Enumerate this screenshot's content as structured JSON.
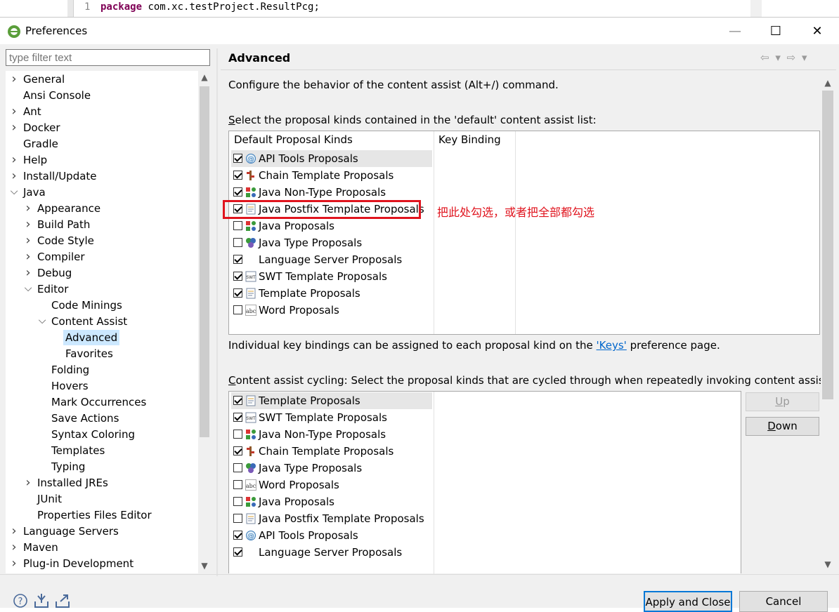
{
  "editor": {
    "line_number": "1",
    "keyword": "package",
    "code": " com.xc.testProject.ResultPcg;"
  },
  "window": {
    "title": "Preferences",
    "minimize_glyph": "—",
    "maximize_glyph": "☐",
    "close_glyph": "✕"
  },
  "filter": {
    "placeholder": "type filter text"
  },
  "tree": [
    {
      "label": "General",
      "level": 0,
      "chevron": ">"
    },
    {
      "label": "Ansi Console",
      "level": 0,
      "chevron": ""
    },
    {
      "label": "Ant",
      "level": 0,
      "chevron": ">"
    },
    {
      "label": "Docker",
      "level": 0,
      "chevron": ">"
    },
    {
      "label": "Gradle",
      "level": 0,
      "chevron": ""
    },
    {
      "label": "Help",
      "level": 0,
      "chevron": ">"
    },
    {
      "label": "Install/Update",
      "level": 0,
      "chevron": ">"
    },
    {
      "label": "Java",
      "level": 0,
      "chevron": "v"
    },
    {
      "label": "Appearance",
      "level": 1,
      "chevron": ">"
    },
    {
      "label": "Build Path",
      "level": 1,
      "chevron": ">"
    },
    {
      "label": "Code Style",
      "level": 1,
      "chevron": ">"
    },
    {
      "label": "Compiler",
      "level": 1,
      "chevron": ">"
    },
    {
      "label": "Debug",
      "level": 1,
      "chevron": ">"
    },
    {
      "label": "Editor",
      "level": 1,
      "chevron": "v"
    },
    {
      "label": "Code Minings",
      "level": 2,
      "chevron": ""
    },
    {
      "label": "Content Assist",
      "level": 2,
      "chevron": "v"
    },
    {
      "label": "Advanced",
      "level": 3,
      "chevron": "",
      "selected": true
    },
    {
      "label": "Favorites",
      "level": 3,
      "chevron": ""
    },
    {
      "label": "Folding",
      "level": 2,
      "chevron": ""
    },
    {
      "label": "Hovers",
      "level": 2,
      "chevron": ""
    },
    {
      "label": "Mark Occurrences",
      "level": 2,
      "chevron": ""
    },
    {
      "label": "Save Actions",
      "level": 2,
      "chevron": ""
    },
    {
      "label": "Syntax Coloring",
      "level": 2,
      "chevron": ""
    },
    {
      "label": "Templates",
      "level": 2,
      "chevron": ""
    },
    {
      "label": "Typing",
      "level": 2,
      "chevron": ""
    },
    {
      "label": "Installed JREs",
      "level": 1,
      "chevron": ">"
    },
    {
      "label": "JUnit",
      "level": 1,
      "chevron": ""
    },
    {
      "label": "Properties Files Editor",
      "level": 1,
      "chevron": ""
    },
    {
      "label": "Language Servers",
      "level": 0,
      "chevron": ">"
    },
    {
      "label": "Maven",
      "level": 0,
      "chevron": ">"
    },
    {
      "label": "Plug-in Development",
      "level": 0,
      "chevron": ">"
    }
  ],
  "page": {
    "title": "Advanced",
    "nav": "⇦ ▾ ⇨ ▾",
    "description": "Configure the behavior of the content assist (Alt+/) command.",
    "default_list_label_u": "S",
    "default_list_label_rest": "elect the proposal kinds contained in the 'default' content assist list:",
    "col_kinds": "Default Proposal Kinds",
    "col_binding": "Key Binding",
    "keys_text_before": "Individual key bindings can be assigned to each proposal kind on the ",
    "keys_link": "'Keys'",
    "keys_text_after": " preference page.",
    "cycling_label_u": "C",
    "cycling_label_rest": "ontent assist cycling: Select the proposal kinds that are cycled through when repeatedly invoking content assist:",
    "up_u": "U",
    "up_rest": "p",
    "down_u": "D",
    "down_rest": "own"
  },
  "default_kinds": [
    {
      "label": "API Tools Proposals",
      "checked": true,
      "icon": "api-tools-icon"
    },
    {
      "label": "Chain Template Proposals",
      "checked": true,
      "icon": "chain-template-icon"
    },
    {
      "label": "Java Non-Type Proposals",
      "checked": true,
      "icon": "java-non-type-icon"
    },
    {
      "label": "Java Postfix Template Proposals",
      "checked": true,
      "icon": "template-icon"
    },
    {
      "label": "Java Proposals",
      "checked": false,
      "icon": "java-non-type-icon"
    },
    {
      "label": "Java Type Proposals",
      "checked": false,
      "icon": "java-type-icon"
    },
    {
      "label": "Language Server Proposals",
      "checked": true,
      "icon": ""
    },
    {
      "label": "SWT Template Proposals",
      "checked": true,
      "icon": "swt-icon"
    },
    {
      "label": "Template Proposals",
      "checked": true,
      "icon": "template-icon"
    },
    {
      "label": "Word Proposals",
      "checked": false,
      "icon": "word-icon"
    }
  ],
  "cycling_kinds": [
    {
      "label": "Template Proposals",
      "checked": true,
      "icon": "template-icon"
    },
    {
      "label": "SWT Template Proposals",
      "checked": true,
      "icon": "swt-icon"
    },
    {
      "label": "Java Non-Type Proposals",
      "checked": false,
      "icon": "java-non-type-icon"
    },
    {
      "label": "Chain Template Proposals",
      "checked": true,
      "icon": "chain-template-icon"
    },
    {
      "label": "Java Type Proposals",
      "checked": false,
      "icon": "java-type-icon"
    },
    {
      "label": "Word Proposals",
      "checked": false,
      "icon": "word-icon"
    },
    {
      "label": "Java Proposals",
      "checked": false,
      "icon": "java-non-type-icon"
    },
    {
      "label": "Java Postfix Template Proposals",
      "checked": false,
      "icon": "template-icon"
    },
    {
      "label": "API Tools Proposals",
      "checked": true,
      "icon": "api-tools-icon"
    },
    {
      "label": "Language Server Proposals",
      "checked": true,
      "icon": ""
    }
  ],
  "annotation": "把此处勾选，或者把全部都勾选",
  "footer": {
    "apply_close": "Apply and Close",
    "cancel": "Cancel"
  }
}
